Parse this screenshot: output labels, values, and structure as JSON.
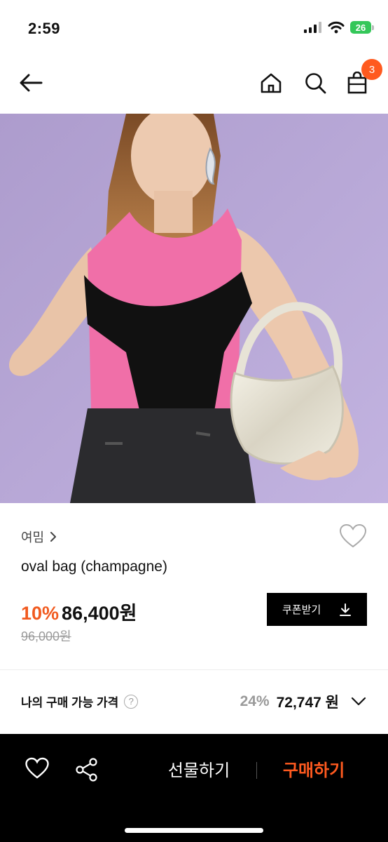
{
  "status": {
    "time": "2:59",
    "battery": "26"
  },
  "header": {
    "cart_count": "3",
    "icons": [
      "back-arrow-icon",
      "home-icon",
      "search-icon",
      "cart-icon"
    ]
  },
  "product": {
    "brand": "여밈",
    "name": "oval bag (champagne)",
    "discount": "10%",
    "price": "86,400원",
    "original_price": "96,000원",
    "coupon_label": "쿠폰받기"
  },
  "my_price": {
    "label": "나의 구매 가능 가격",
    "help": "?",
    "discount": "24%",
    "price": "72,747 원"
  },
  "bottom_bar": {
    "gift_label": "선물하기",
    "buy_label": "구매하기"
  },
  "colors": {
    "accent": "#ff5a1f",
    "image_background": "#b6a5d4"
  }
}
